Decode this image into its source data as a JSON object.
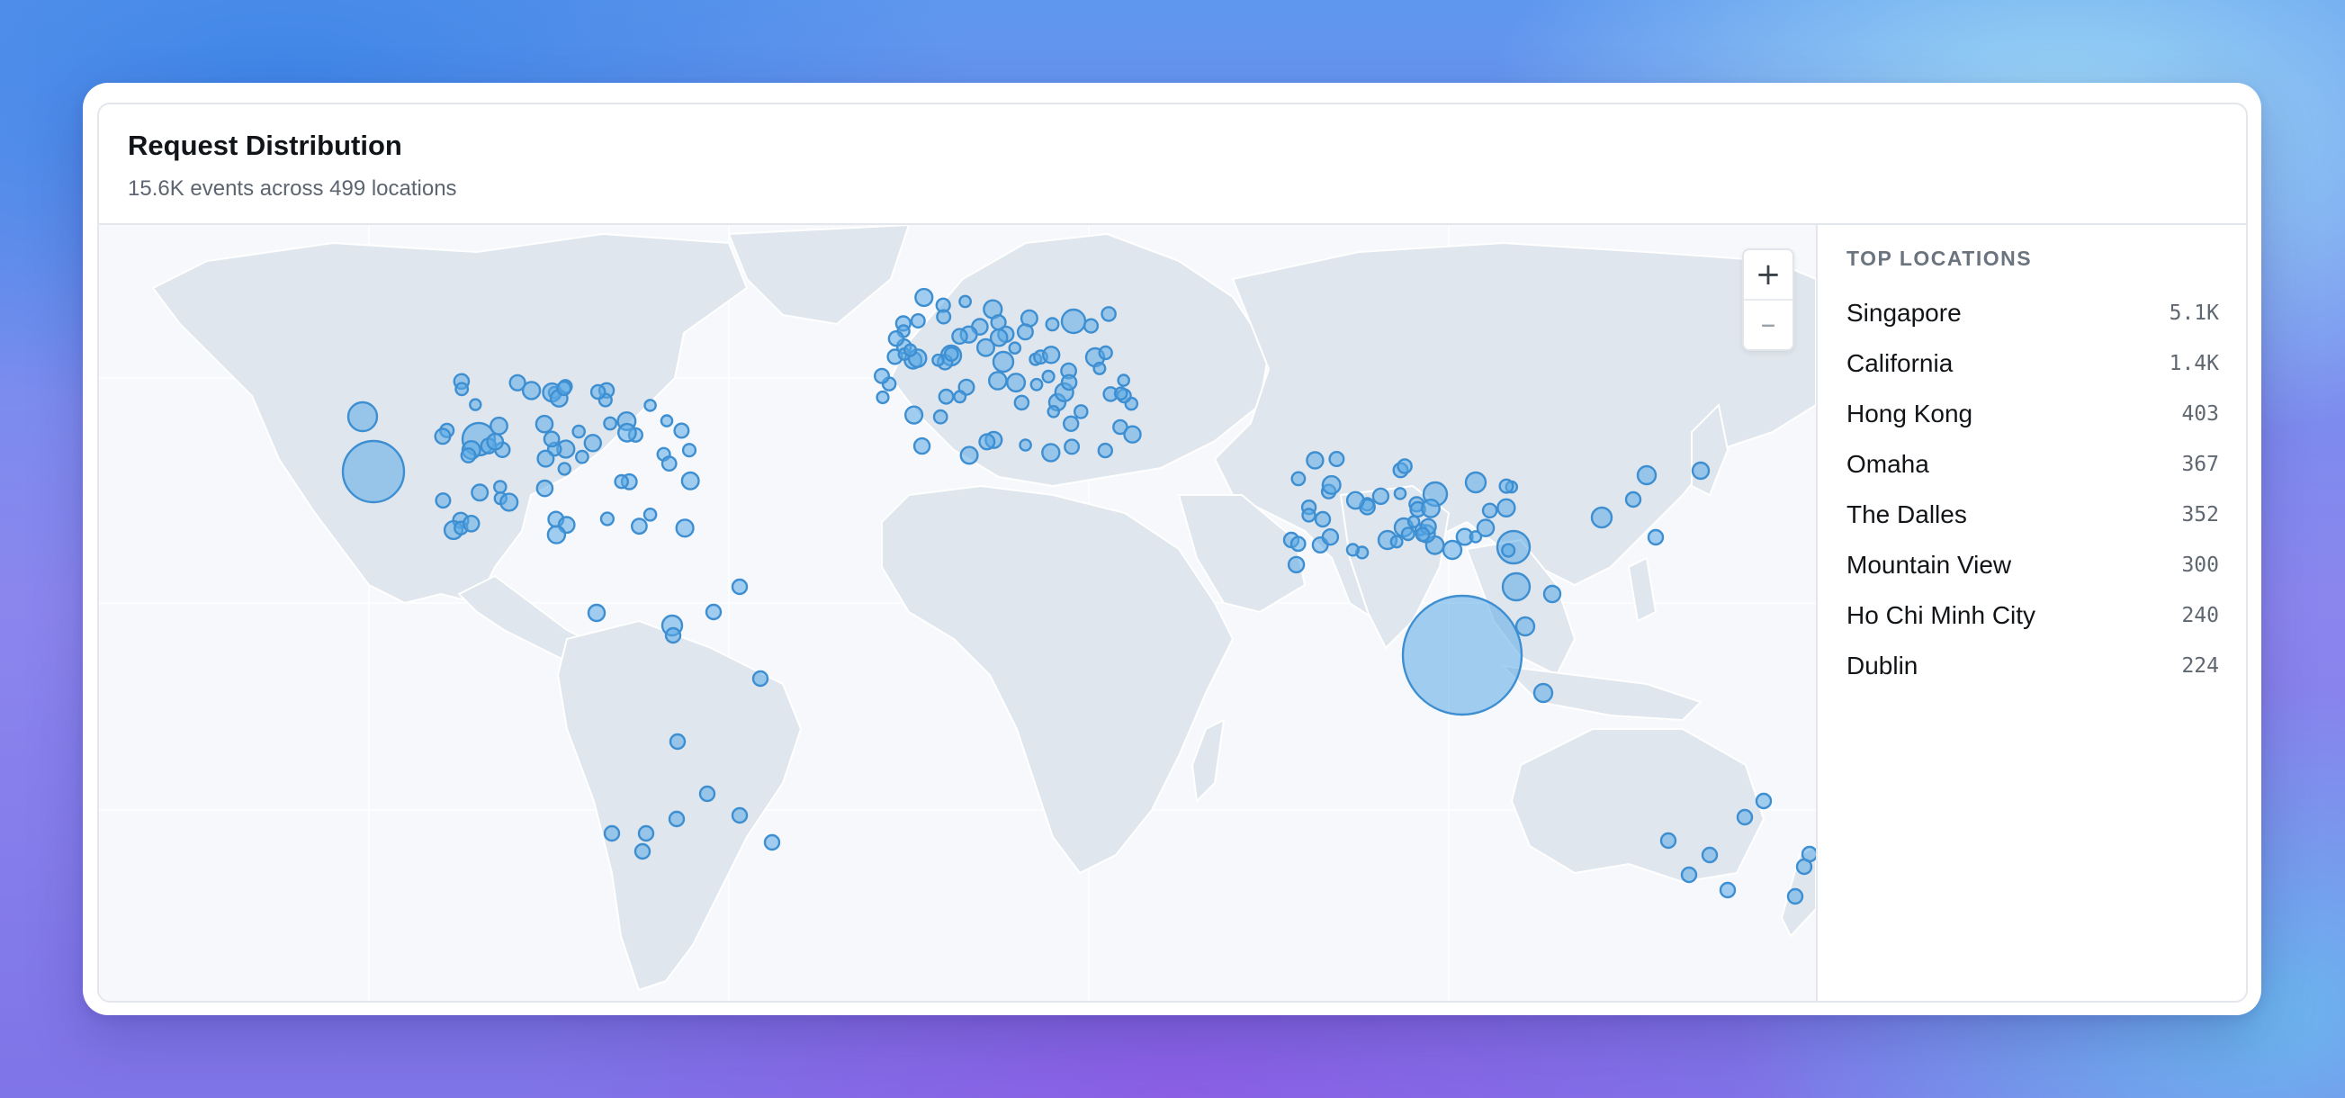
{
  "header": {
    "title": "Request Distribution",
    "subtitle": "15.6K events across 499 locations"
  },
  "map": {
    "zoom_in_label": "+",
    "zoom_out_label": "–",
    "bubble_color": "#5aa9e6",
    "land_color": "#dfe6ed",
    "ocean_color": "#f6f8fb"
  },
  "sidebar": {
    "heading": "TOP LOCATIONS",
    "locations": [
      {
        "name": "Singapore",
        "value": "5.1K"
      },
      {
        "name": "California",
        "value": "1.4K"
      },
      {
        "name": "Hong Kong",
        "value": "403"
      },
      {
        "name": "Omaha",
        "value": "367"
      },
      {
        "name": "The Dalles",
        "value": "352"
      },
      {
        "name": "Mountain View",
        "value": "300"
      },
      {
        "name": "Ho Chi Minh City",
        "value": "240"
      },
      {
        "name": "Dublin",
        "value": "224"
      }
    ]
  }
}
